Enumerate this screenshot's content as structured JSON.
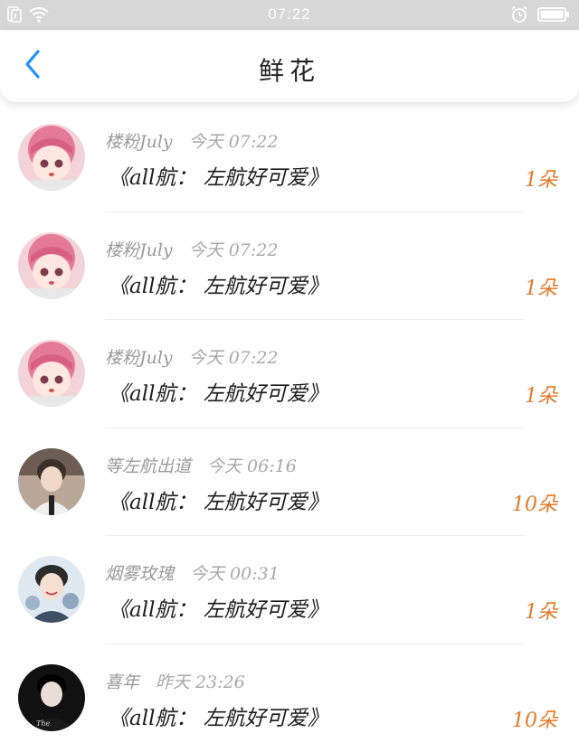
{
  "status_bar": {
    "time": "07:22",
    "icons": [
      "sim-icon",
      "wifi-icon",
      "alarm-icon",
      "battery-icon"
    ]
  },
  "header": {
    "title": "鲜花",
    "back_icon": "chevron-left-icon"
  },
  "colors": {
    "accent_blue": "#1e90ff",
    "gift_orange": "#e5782a",
    "meta_gray": "#9a9a9a"
  },
  "gifts": [
    {
      "name": "楼粉July",
      "time": "今天 07:22",
      "message": "《all航： 左航好可爱》",
      "amount": "1朵",
      "avatar": "pink-hair-anime-avatar"
    },
    {
      "name": "楼粉July",
      "time": "今天 07:22",
      "message": "《all航： 左航好可爱》",
      "amount": "1朵",
      "avatar": "pink-hair-anime-avatar"
    },
    {
      "name": "楼粉July",
      "time": "今天 07:22",
      "message": "《all航： 左航好可爱》",
      "amount": "1朵",
      "avatar": "pink-hair-anime-avatar"
    },
    {
      "name": "等左航出道",
      "time": "今天 06:16",
      "message": "《all航： 左航好可爱》",
      "amount": "10朵",
      "avatar": "boy-photo-avatar"
    },
    {
      "name": "烟雾玫瑰",
      "time": "今天 00:31",
      "message": "《all航： 左航好可爱》",
      "amount": "1朵",
      "avatar": "boy-smiling-avatar"
    },
    {
      "name": "喜年",
      "time": "昨天 23:26",
      "message": "《all航： 左航好可爱》",
      "amount": "10朵",
      "avatar": "dark-photo-avatar"
    }
  ]
}
